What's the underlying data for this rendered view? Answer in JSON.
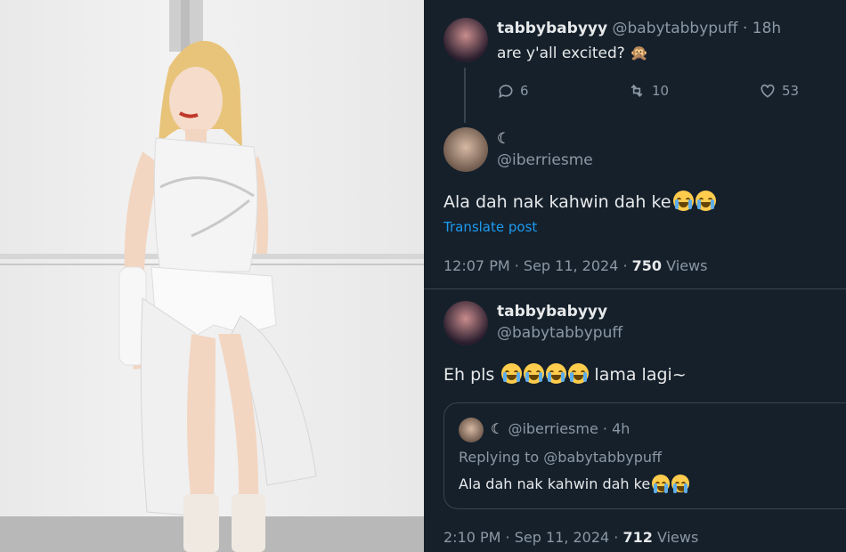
{
  "tweet1": {
    "display_name": "tabbybabyyy",
    "handle": "@babytabbypuff",
    "time": "18h",
    "separator": "·",
    "text": "are y'all excited? 🙊",
    "replies": "6",
    "retweets": "10",
    "likes": "53"
  },
  "reply_main": {
    "display_name": "☾",
    "handle": "@iberriesme",
    "text": "Ala dah nak kahwin dah ke",
    "translate": "Translate post",
    "timestamp": "12:07 PM · Sep 11, 2024 · ",
    "views_count": "750",
    "views_label": "Views"
  },
  "reply2": {
    "display_name": "tabbybabyyy",
    "handle": "@babytabbypuff",
    "text_before": "Eh pls",
    "text_after": "lama lagi~",
    "quote": {
      "display_name": "☾",
      "handle": "@iberriesme",
      "time": "· 4h",
      "replying_to": "Replying to @babytabbypuff",
      "text": "Ala dah nak kahwin dah ke"
    },
    "timestamp": "2:10 PM · Sep 11, 2024 · ",
    "views_count": "712",
    "views_label": "Views"
  },
  "colors": {
    "background": "#15202b",
    "link": "#1d9bf0",
    "muted": "#8b98a5",
    "text": "#e7e9ea"
  }
}
